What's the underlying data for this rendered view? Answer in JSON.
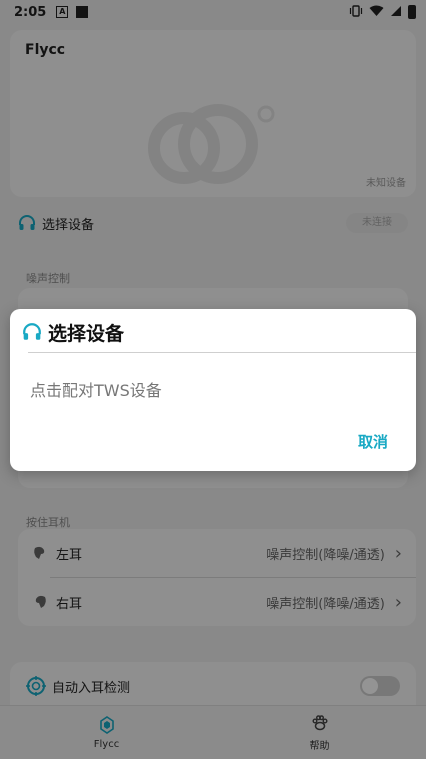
{
  "status_bar": {
    "time": "2:05",
    "notification_icons": [
      "a-box-icon",
      "square-icon"
    ],
    "right_icons": [
      "vibrate-icon",
      "wifi-icon",
      "signal-icon",
      "battery-icon"
    ]
  },
  "device_card": {
    "name": "Flycc",
    "status_text": "未知设备"
  },
  "select_device": {
    "label": "选择设备",
    "pill_text": "未连接"
  },
  "noise_section": {
    "label": "噪声控制"
  },
  "press_section": {
    "label": "按住耳机",
    "rows": [
      {
        "label": "左耳",
        "value": "噪声控制(降噪/通透)"
      },
      {
        "label": "右耳",
        "value": "噪声控制(降噪/通透)"
      }
    ]
  },
  "auto_ear": {
    "label": "自动入耳检测"
  },
  "bottom_nav": {
    "items": [
      {
        "label": "Flycc"
      },
      {
        "label": "帮助"
      }
    ]
  },
  "dialog": {
    "title": "选择设备",
    "message": "点击配对TWS设备",
    "cancel_label": "取消"
  },
  "colors": {
    "accent": "#19a9c4",
    "scrim": "#000000"
  }
}
